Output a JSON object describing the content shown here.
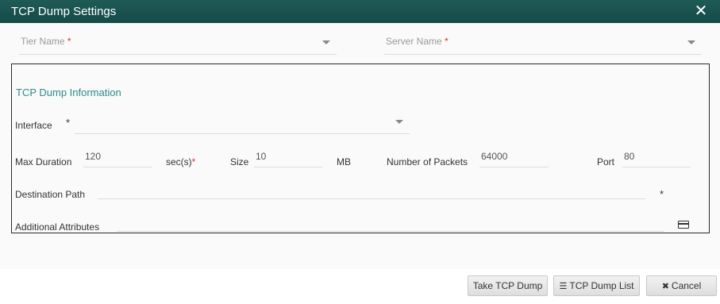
{
  "dialog": {
    "title": "TCP Dump Settings",
    "close_glyph": "✕"
  },
  "top_fields": {
    "tier": {
      "placeholder": "Tier Name",
      "required": "*"
    },
    "server": {
      "placeholder": "Server Name",
      "required": "*"
    }
  },
  "info_section": {
    "legend": "TCP Dump Information",
    "interface_label": "Interface",
    "interface_required": "*",
    "max_duration_label": "Max Duration",
    "max_duration_value": "120",
    "duration_unit": "sec(s)",
    "duration_required": "*",
    "size_label": "Size",
    "size_value": "10",
    "size_unit": "MB",
    "packets_label": "Number of Packets",
    "packets_value": "64000",
    "port_label": "Port",
    "port_value": "80",
    "destination_label": "Destination Path",
    "destination_value": "",
    "destination_required": "*",
    "additional_label": "Additional Attributes",
    "additional_value": ""
  },
  "buttons": {
    "take_dump": "Take TCP Dump",
    "dump_list": "TCP Dump List",
    "dump_list_icon": "list-icon",
    "cancel": "Cancel",
    "cancel_icon": "close-icon"
  },
  "colors": {
    "titlebar": "#1f5a57",
    "legend": "#2a8a8a",
    "required": "#d9342b"
  }
}
